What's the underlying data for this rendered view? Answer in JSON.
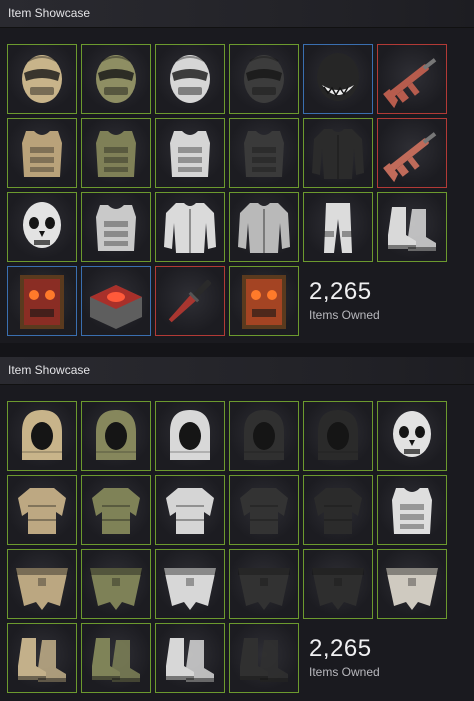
{
  "showcase1": {
    "title": "Item Showcase",
    "items_owned_count": "2,265",
    "items_owned_label": "Items Owned",
    "tiles": [
      {
        "name": "facemask-tan",
        "border": "green",
        "icon": "facemask",
        "color": "#c8b48a"
      },
      {
        "name": "facemask-olive",
        "border": "green",
        "icon": "facemask",
        "color": "#8e8e63"
      },
      {
        "name": "facemask-white",
        "border": "green",
        "icon": "facemask",
        "color": "#d6d6d6"
      },
      {
        "name": "facemask-black",
        "border": "green",
        "icon": "facemask",
        "color": "#3c3c3c"
      },
      {
        "name": "monster-mask",
        "border": "blue",
        "icon": "monster",
        "color": "#262626"
      },
      {
        "name": "rifle-red",
        "border": "red",
        "icon": "rifle",
        "color": "#b75c4d"
      },
      {
        "name": "chestplate-tan",
        "border": "green",
        "icon": "vest",
        "color": "#b9a27a"
      },
      {
        "name": "chestplate-olive",
        "border": "green",
        "icon": "vest",
        "color": "#7f8057"
      },
      {
        "name": "chestplate-white",
        "border": "green",
        "icon": "vest",
        "color": "#d5d5d5"
      },
      {
        "name": "chestplate-black",
        "border": "green",
        "icon": "vest",
        "color": "#3a3a3a"
      },
      {
        "name": "hoodie-black",
        "border": "green",
        "icon": "jacket",
        "color": "#2b2b2b"
      },
      {
        "name": "rifle-red-2",
        "border": "red",
        "icon": "rifle",
        "color": "#c06b5a"
      },
      {
        "name": "skull-mask-white",
        "border": "green",
        "icon": "skull",
        "color": "#e3e3e3"
      },
      {
        "name": "vest-black-white",
        "border": "green",
        "icon": "vest",
        "color": "#c9c9c9"
      },
      {
        "name": "jacket-white",
        "border": "green",
        "icon": "jacket",
        "color": "#dadada"
      },
      {
        "name": "jacket-grey",
        "border": "green",
        "icon": "jacket",
        "color": "#b9b9b9"
      },
      {
        "name": "pants-white",
        "border": "green",
        "icon": "pants",
        "color": "#dcdcdc"
      },
      {
        "name": "boots-white",
        "border": "green",
        "icon": "boots",
        "color": "#d9d9d9"
      },
      {
        "name": "door-red-eyes",
        "border": "blue",
        "icon": "door",
        "color": "#8a2d24"
      },
      {
        "name": "crate-red",
        "border": "blue",
        "icon": "crate",
        "color": "#a8302a"
      },
      {
        "name": "knife-red",
        "border": "red",
        "icon": "knife",
        "color": "#a83630"
      },
      {
        "name": "double-door-red",
        "border": "green",
        "icon": "door",
        "color": "#a44423"
      }
    ]
  },
  "showcase2": {
    "title": "Item Showcase",
    "items_owned_count": "2,265",
    "items_owned_label": "Items Owned",
    "tiles": [
      {
        "name": "hood-tan",
        "border": "green",
        "icon": "hood",
        "color": "#c8b48a"
      },
      {
        "name": "hood-olive",
        "border": "green",
        "icon": "hood",
        "color": "#86875c"
      },
      {
        "name": "hood-white",
        "border": "green",
        "icon": "hood",
        "color": "#d8d8d8"
      },
      {
        "name": "hood-black",
        "border": "green",
        "icon": "hood",
        "color": "#303030"
      },
      {
        "name": "hood-black-white",
        "border": "green",
        "icon": "hood",
        "color": "#2a2a2a"
      },
      {
        "name": "skull-mask-white",
        "border": "green",
        "icon": "skull",
        "color": "#e2e2e2"
      },
      {
        "name": "armor-tan",
        "border": "green",
        "icon": "armor",
        "color": "#bda882"
      },
      {
        "name": "armor-olive",
        "border": "green",
        "icon": "armor",
        "color": "#7f8257"
      },
      {
        "name": "armor-white",
        "border": "green",
        "icon": "armor",
        "color": "#d5d5d5"
      },
      {
        "name": "armor-black",
        "border": "green",
        "icon": "armor",
        "color": "#333333"
      },
      {
        "name": "armor-black-white",
        "border": "green",
        "icon": "armor",
        "color": "#2b2b2b"
      },
      {
        "name": "vest-white-black",
        "border": "green",
        "icon": "vest",
        "color": "#dedede"
      },
      {
        "name": "kilt-tan",
        "border": "green",
        "icon": "kilt",
        "color": "#bba781"
      },
      {
        "name": "kilt-olive",
        "border": "green",
        "icon": "kilt",
        "color": "#7e8157"
      },
      {
        "name": "kilt-white",
        "border": "green",
        "icon": "kilt",
        "color": "#d7d7d7"
      },
      {
        "name": "kilt-black",
        "border": "green",
        "icon": "kilt",
        "color": "#323232"
      },
      {
        "name": "kilt-black-white",
        "border": "green",
        "icon": "kilt",
        "color": "#2e2e2e"
      },
      {
        "name": "kilt-white-black",
        "border": "green",
        "icon": "kilt",
        "color": "#cfcac0"
      },
      {
        "name": "boots-tan",
        "border": "green",
        "icon": "boots",
        "color": "#c3b08a"
      },
      {
        "name": "boots-olive",
        "border": "green",
        "icon": "boots",
        "color": "#7f8358"
      },
      {
        "name": "boots-white",
        "border": "green",
        "icon": "boots",
        "color": "#d7d7d7"
      },
      {
        "name": "boots-black",
        "border": "green",
        "icon": "boots",
        "color": "#303030"
      }
    ]
  }
}
